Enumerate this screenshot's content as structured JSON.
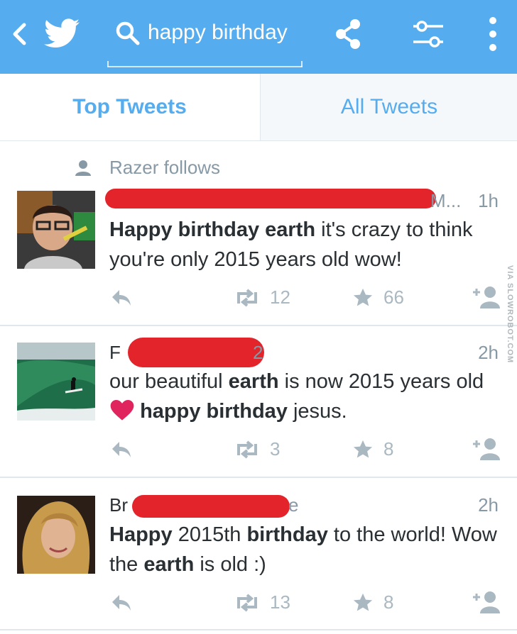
{
  "search": {
    "query": "happy birthday"
  },
  "tabs": [
    {
      "label": "Top Tweets",
      "active": true
    },
    {
      "label": "All Tweets",
      "active": false
    }
  ],
  "context": {
    "follows_label": "Razer follows"
  },
  "tweets": [
    {
      "name_visible": "M...",
      "time": "1h",
      "body_segments": [
        [
          "Happy birthday earth",
          true
        ],
        [
          " it's crazy to think you're only 2015 years old wow!",
          false
        ]
      ],
      "retweets": "12",
      "favorites": "66"
    },
    {
      "name_visible": "F",
      "name_visible_end": "2",
      "time": "2h",
      "body_segments": [
        [
          "our beautiful ",
          false
        ],
        [
          "earth",
          true
        ],
        [
          " is now 2015 years old",
          false
        ],
        [
          "HEART",
          false
        ],
        [
          " ",
          false
        ],
        [
          "happy birthday",
          true
        ],
        [
          " jesus.",
          false
        ]
      ],
      "retweets": "3",
      "favorites": "8"
    },
    {
      "name_visible": "Br",
      "name_visible_end": "e",
      "time": "2h",
      "body_segments": [
        [
          "Happy",
          true
        ],
        [
          " 2015th ",
          false
        ],
        [
          "birthday",
          true
        ],
        [
          " to the world! Wow the ",
          false
        ],
        [
          "earth",
          true
        ],
        [
          " is old :)",
          false
        ]
      ],
      "retweets": "13",
      "favorites": "8"
    }
  ],
  "watermark": "VIA SLOWROBOT.COM",
  "colors": {
    "brand": "#55acee",
    "redaction": "#e3242b",
    "heart": "#e0245e",
    "muted": "#8899a6",
    "action": "#aab8c2"
  },
  "icons": [
    "back-chevron-icon",
    "twitter-bird-icon",
    "search-icon",
    "share-icon",
    "filter-icon",
    "overflow-menu-icon",
    "person-icon",
    "reply-icon",
    "retweet-icon",
    "star-icon",
    "follow-icon",
    "heart-icon"
  ]
}
